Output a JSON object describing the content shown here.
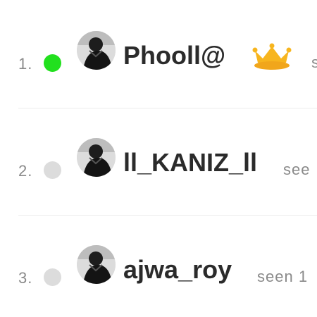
{
  "list": {
    "rows": [
      {
        "rank": "1.",
        "username": "Phooll@",
        "status": "online",
        "status_color": "#22e01e",
        "badge": "crown-icon",
        "seen": "s"
      },
      {
        "rank": "2.",
        "username": "ll_KANIZ_ll",
        "status": "offline",
        "status_color": "#dcdcdc",
        "seen": "see"
      },
      {
        "rank": "3.",
        "username": "ajwa_roy",
        "status": "offline",
        "status_color": "#dcdcdc",
        "seen": "seen 1"
      }
    ]
  },
  "colors": {
    "online": "#22e01e",
    "offline": "#dcdcdc",
    "crown": "#f7b51e",
    "username_text": "#2b2b2b",
    "muted_text": "#8a8a8a"
  }
}
